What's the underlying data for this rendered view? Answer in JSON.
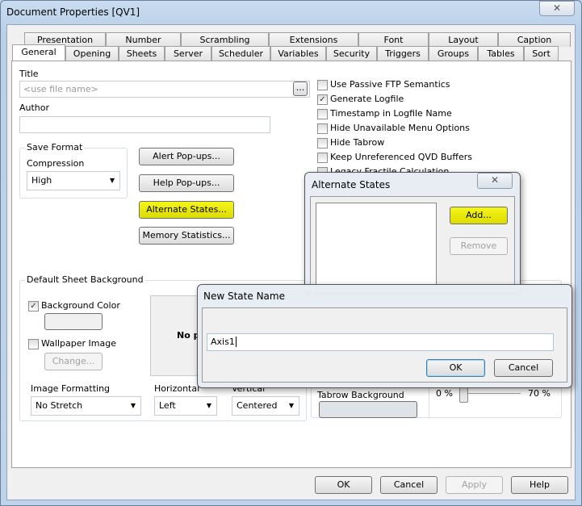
{
  "window": {
    "title": "Document Properties [QV1]",
    "close": "✕"
  },
  "tabs_row1": [
    "Presentation",
    "Number",
    "Scrambling",
    "Extensions",
    "Font",
    "Layout",
    "Caption"
  ],
  "tabs_row2": [
    "General",
    "Opening",
    "Sheets",
    "Server",
    "Scheduler",
    "Variables",
    "Security",
    "Triggers",
    "Groups",
    "Tables",
    "Sort"
  ],
  "selected_tab": "General",
  "general": {
    "title_label": "Title",
    "title_placeholder": "<use file name>",
    "ellipsis": "...",
    "author_label": "Author",
    "author_value": "",
    "save_format": {
      "label": "Save Format",
      "compression_label": "Compression",
      "compression_value": "High"
    },
    "buttons": {
      "alert": "Alert Pop-ups...",
      "help": "Help Pop-ups...",
      "alternate": "Alternate States...",
      "memory": "Memory Statistics..."
    },
    "checkboxes": [
      {
        "label": "Use Passive FTP Semantics",
        "checked": false
      },
      {
        "label": "Generate Logfile",
        "checked": true
      },
      {
        "label": "Timestamp in Logfile Name",
        "checked": false
      },
      {
        "label": "Hide Unavailable Menu Options",
        "checked": false
      },
      {
        "label": "Hide Tabrow",
        "checked": false
      },
      {
        "label": "Keep Unreferenced QVD Buffers",
        "checked": false
      },
      {
        "label": "Legacy Fractile Calculation",
        "checked": false
      }
    ],
    "sheet_bg": {
      "label": "Default Sheet Background",
      "bg_color_label": "Background Color",
      "bg_color_checked": true,
      "wallpaper_label": "Wallpaper Image",
      "wallpaper_checked": false,
      "change": "Change...",
      "preview": "No p",
      "image_formatting_label": "Image Formatting",
      "image_formatting_value": "No Stretch",
      "horizontal_label": "Horizontal",
      "horizontal_value": "Left",
      "vertical_label": "Vertical",
      "vertical_value": "Centered"
    },
    "tabrow_bg_label": "Tabrow Background",
    "transparency": {
      "min": "0 %",
      "max": "70 %",
      "value_percent": 0
    }
  },
  "footer": {
    "ok": "OK",
    "cancel": "Cancel",
    "apply": "Apply",
    "help": "Help"
  },
  "alternate_states": {
    "title": "Alternate States",
    "add": "Add...",
    "remove": "Remove",
    "close": "✕"
  },
  "new_state": {
    "title": "New State Name",
    "value": "Axis1",
    "ok": "OK",
    "cancel": "Cancel"
  }
}
